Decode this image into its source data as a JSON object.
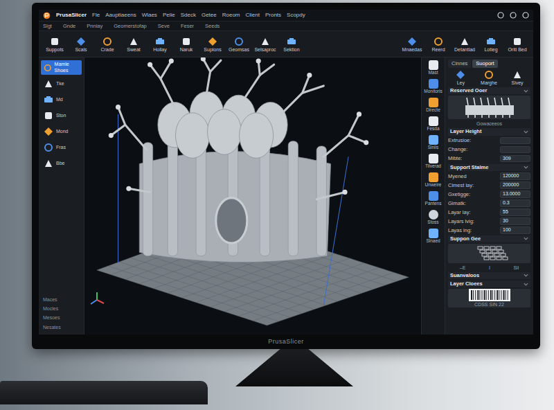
{
  "window": {
    "title": "PrusaSlicer"
  },
  "menu": [
    "Fle",
    "Aauptiaeens",
    "Wlaes",
    "Pelie",
    "Sdeck",
    "Getee",
    "Roeom",
    "Client",
    "Pronts",
    "Scopdy"
  ],
  "submenu": [
    "Slgt",
    "Gnde",
    "Pnniay",
    "Geomerstofap",
    "Seve",
    "Feser",
    "Seeds"
  ],
  "toolbar": [
    "Suppots",
    "Scals",
    "Crade",
    "Sweat",
    "Hollay",
    "Naruk",
    "Supions",
    "Geomsas",
    "Selsaproc",
    "Sektion"
  ],
  "toolbar_right": [
    "Mnaedas",
    "Reerd",
    "Detantiad",
    "Lotieg",
    "Oriti Bed"
  ],
  "left_tools": [
    {
      "label": "Mamle Shoes",
      "selected": true
    },
    {
      "label": "Tke",
      "selected": false
    },
    {
      "label": "Md",
      "selected": false
    },
    {
      "label": "Ston",
      "selected": false
    },
    {
      "label": "Mond",
      "selected": false
    },
    {
      "label": "Fras",
      "selected": false
    },
    {
      "label": "Bbe",
      "selected": false
    }
  ],
  "left_list": [
    "Maces",
    "Mocles",
    "Mesoes",
    "Nesates"
  ],
  "right_column": [
    {
      "label": "Mast",
      "selected": false
    },
    {
      "label": "Monitoris",
      "selected": false
    },
    {
      "label": "Directe",
      "selected": false
    },
    {
      "label": "Fesda",
      "selected": false
    },
    {
      "label": "Siniis",
      "selected": false
    },
    {
      "label": "Tilverad",
      "selected": false
    },
    {
      "label": "Unweire",
      "selected": false
    },
    {
      "label": "Pantens",
      "selected": false
    },
    {
      "label": "Stoss",
      "selected": true
    },
    {
      "label": "Slnaed",
      "selected": false
    }
  ],
  "panel": {
    "tabs": [
      {
        "label": "Cinnes",
        "selected": false
      },
      {
        "label": "Suoport",
        "selected": true
      }
    ],
    "modes": [
      "Ley",
      "Marghe",
      "Sivey"
    ],
    "preview_title": "Reserved Ooer",
    "preview_caption": "Gowaceeos",
    "layer_title": "Layer Height",
    "layer_rows": [
      {
        "label": "Extrusioe:"
      },
      {
        "label": "Change:"
      },
      {
        "label": "Mibte:",
        "value": "309"
      }
    ],
    "support_title": "Support Stalme",
    "support_rows": [
      {
        "label": "Myened",
        "value": "120000"
      },
      {
        "label": "Cimest lay:",
        "value": "200000"
      },
      {
        "label": "Gxetigge:",
        "value": "13.0000"
      },
      {
        "label": "Gimatk:",
        "value": "0.3"
      },
      {
        "label": "Layar lay:",
        "value": "55"
      },
      {
        "label": "Layars lvig:",
        "value": "30"
      },
      {
        "label": "Layas ing:",
        "value": "100"
      }
    ],
    "grid_title": "Suppon Gee",
    "grid_captions": [
      "–E",
      "I",
      "Sil"
    ],
    "footer_label": "Suanvaloos",
    "layer_colors_title": "Layer Cloees",
    "layer_colors_caption": "CDSS SIN 22"
  },
  "monitor": {
    "brand": "PrusaSlicer"
  }
}
